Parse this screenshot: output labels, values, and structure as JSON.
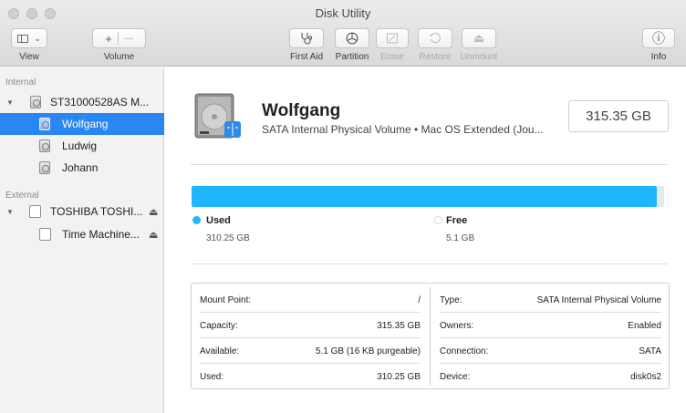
{
  "window": {
    "title": "Disk Utility"
  },
  "toolbar": {
    "view_label": "View",
    "volume_label": "Volume",
    "first_aid_label": "First Aid",
    "partition_label": "Partition",
    "erase_label": "Erase",
    "restore_label": "Restore",
    "unmount_label": "Unmount",
    "info_label": "Info",
    "add_symbol": "+",
    "remove_symbol": "—",
    "info_symbol": "ⓘ"
  },
  "sidebar": {
    "internal_header": "Internal",
    "external_header": "External",
    "internal_disk": "ST31000528AS M...",
    "volumes": [
      "Wolfgang",
      "Ludwig",
      "Johann"
    ],
    "external_disk": "TOSHIBA TOSHI...",
    "external_volume": "Time Machine...",
    "eject_symbol": "⏏"
  },
  "volume": {
    "name": "Wolfgang",
    "subtitle": "SATA Internal Physical Volume • Mac OS Extended (Jou...",
    "capacity": "315.35 GB"
  },
  "usage": {
    "used_label": "Used",
    "used_value": "310.25 GB",
    "free_label": "Free",
    "free_value": "5.1 GB",
    "used_fraction": 0.984,
    "used_color": "#1fb7fb",
    "free_color": "#e9e9e9"
  },
  "info": {
    "left": [
      {
        "key": "Mount Point:",
        "value": "/"
      },
      {
        "key": "Capacity:",
        "value": "315.35 GB"
      },
      {
        "key": "Available:",
        "value": "5.1 GB (16 KB purgeable)"
      },
      {
        "key": "Used:",
        "value": "310.25 GB"
      }
    ],
    "right": [
      {
        "key": "Type:",
        "value": "SATA Internal Physical Volume"
      },
      {
        "key": "Owners:",
        "value": "Enabled"
      },
      {
        "key": "Connection:",
        "value": "SATA"
      },
      {
        "key": "Device:",
        "value": "disk0s2"
      }
    ]
  },
  "colors": {
    "selection": "#2a86f3",
    "accent": "#1fb7fb"
  }
}
